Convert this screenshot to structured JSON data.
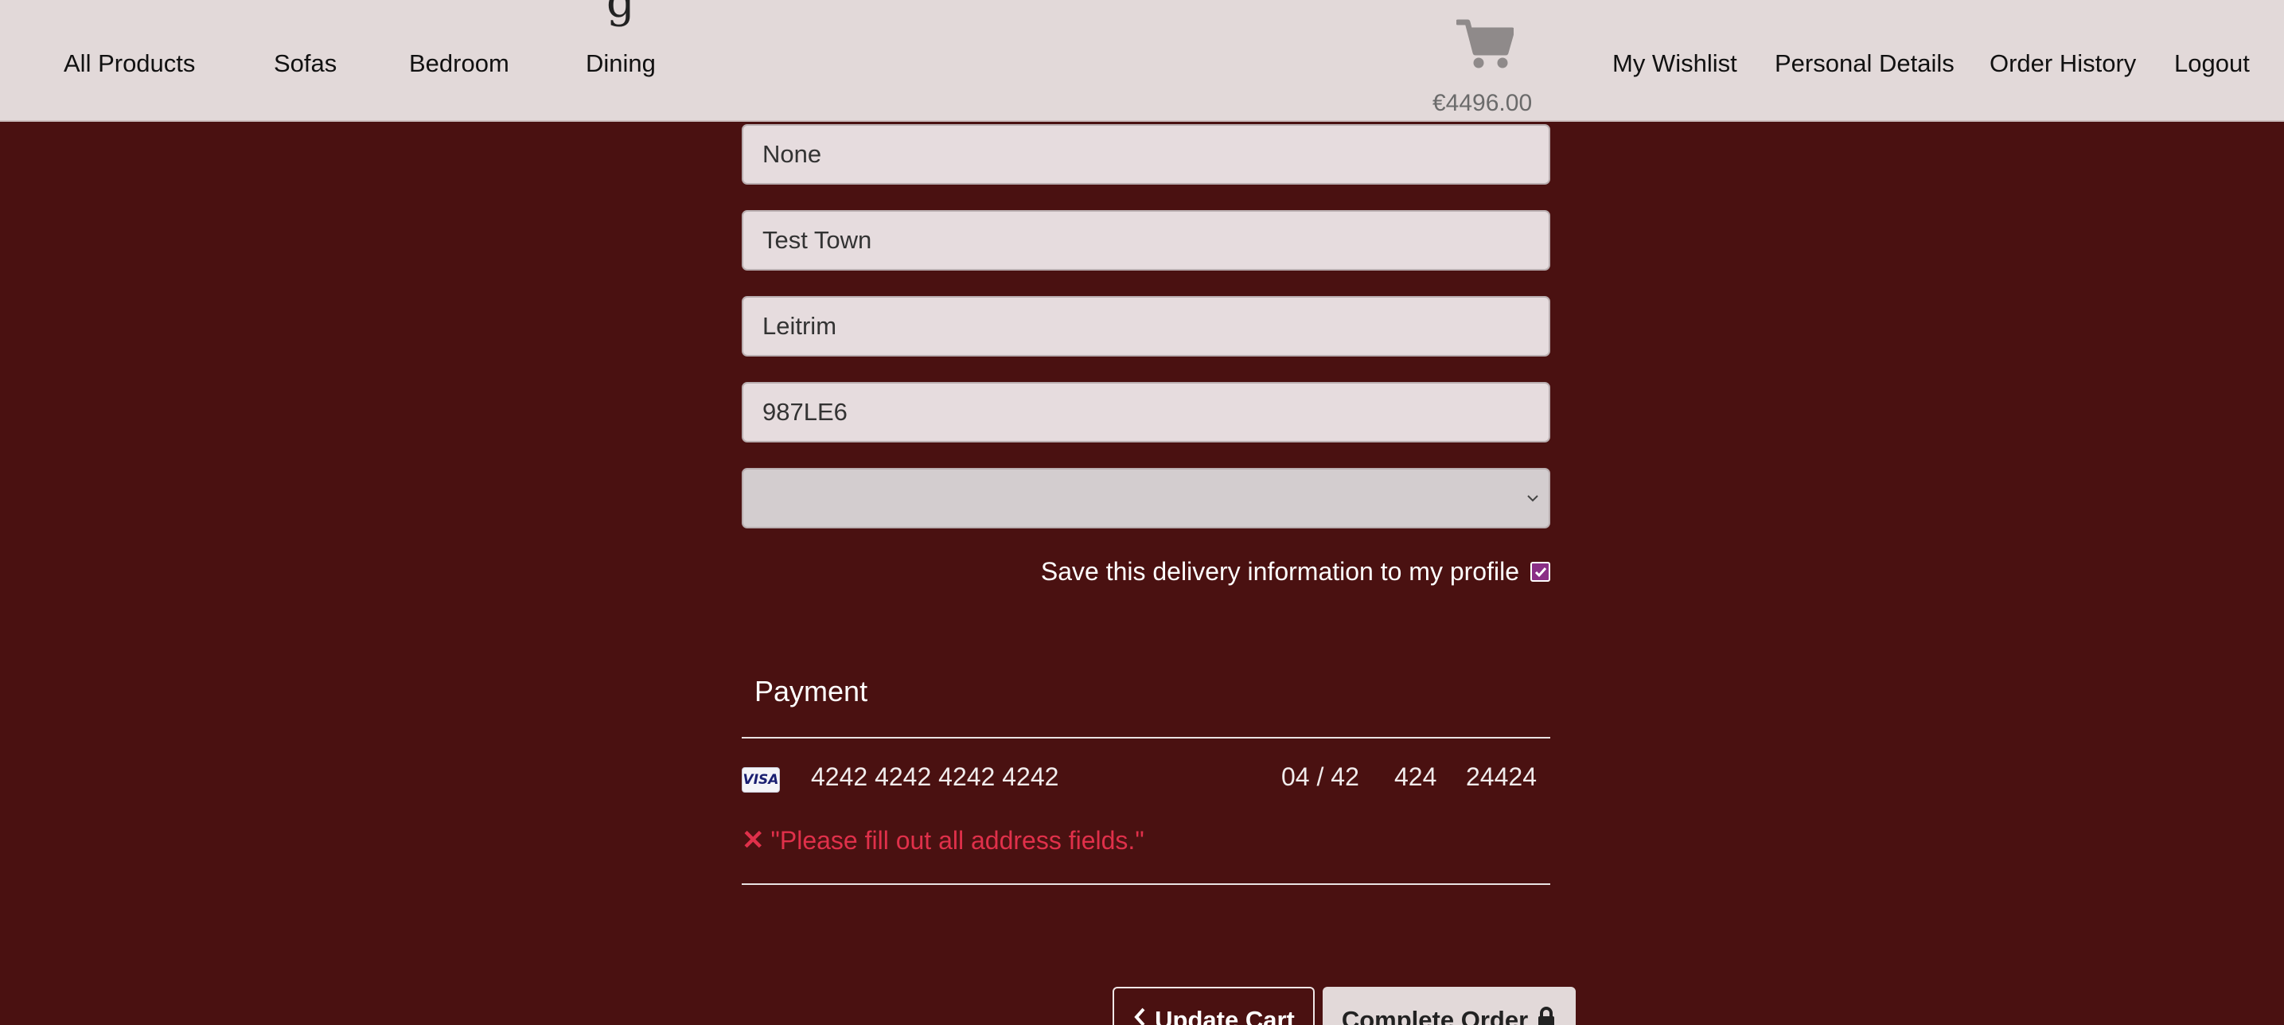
{
  "header": {
    "logo_fragment": "g",
    "nav_left": [
      "All Products",
      "Sofas",
      "Bedroom",
      "Dining"
    ],
    "cart_icon": "shopping-cart-icon",
    "cart_total": "€4496.00",
    "nav_right": [
      "My Wishlist",
      "Personal Details",
      "Order History",
      "Logout"
    ]
  },
  "delivery": {
    "address_line_2": "None",
    "town": "Test Town",
    "county": "Leitrim",
    "postcode": "987LE6",
    "country_selected": "",
    "save_label": "Save this delivery information to my profile",
    "save_checked": true
  },
  "payment": {
    "title": "Payment",
    "card_brand": "VISA",
    "card_number": "4242 4242 4242 4242",
    "expiry": "04 / 42",
    "cvc": "424",
    "postal": "24424",
    "error_icon": "✕",
    "error_message": "\"Please fill out all address fields.\""
  },
  "actions": {
    "update_cart": "Update Cart",
    "complete_order": "Complete Order"
  },
  "colors": {
    "background": "#4a1111",
    "header": "#e2d9d9",
    "checkbox": "#8a2e86",
    "error": "#e0304a"
  }
}
